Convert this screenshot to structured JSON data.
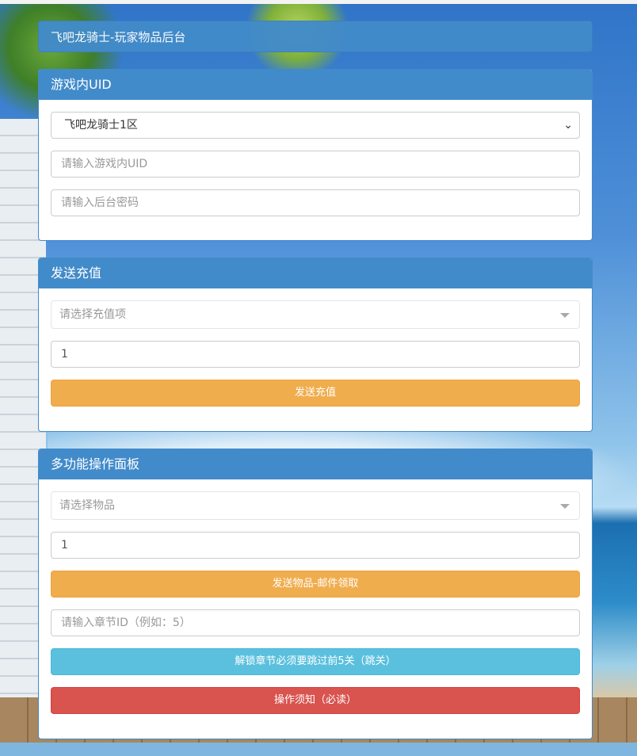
{
  "page_title": "飞吧龙骑士-玩家物品后台",
  "uid_panel": {
    "heading": "游戏内UID",
    "server_select": "飞吧龙骑士1区",
    "uid_placeholder": "请输入游戏内UID",
    "password_placeholder": "请输入后台密码"
  },
  "recharge_panel": {
    "heading": "发送充值",
    "select_placeholder": "请选择充值项",
    "quantity": "1",
    "send_label": "发送充值"
  },
  "multi_panel": {
    "heading": "多功能操作面板",
    "item_placeholder": "请选择物品",
    "quantity": "1",
    "send_mail_label": "发送物品-邮件领取",
    "chapter_placeholder": "请输入章节ID（例如：5）",
    "unlock_label": "解锁章节必须要跳过前5关（跳关）",
    "notice_label": "操作须知（必读）"
  }
}
